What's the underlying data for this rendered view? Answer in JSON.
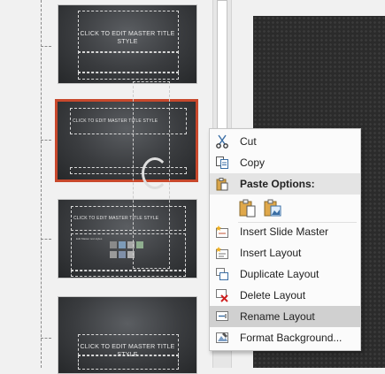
{
  "thumbnails": [
    {
      "title": "CLICK TO EDIT MASTER TITLE STYLE",
      "selected": false
    },
    {
      "title": "CLICK TO EDIT MASTER TITLE STYLE",
      "selected": true
    },
    {
      "title": "CLICK TO EDIT MASTER TITLE STYLE",
      "selected": false,
      "body": "Edit Master text styles"
    },
    {
      "title": "CLICK TO EDIT MASTER TITLE STYLE",
      "selected": false
    }
  ],
  "context_menu": {
    "items": [
      {
        "label": "Cut",
        "icon": "scissors-icon"
      },
      {
        "label": "Copy",
        "icon": "copy-icon"
      },
      {
        "label": "Paste Options:",
        "icon": "paste-icon",
        "header": true
      },
      {
        "label": "Insert Slide Master",
        "icon": "insert-slide-master-icon"
      },
      {
        "label": "Insert Layout",
        "icon": "insert-layout-icon"
      },
      {
        "label": "Duplicate Layout",
        "icon": "duplicate-layout-icon"
      },
      {
        "label": "Delete Layout",
        "icon": "delete-layout-icon"
      },
      {
        "label": "Rename Layout",
        "icon": "rename-layout-icon",
        "highlighted": true
      },
      {
        "label": "Format Background...",
        "icon": "format-background-icon"
      }
    ],
    "paste_options": [
      {
        "icon": "paste-use-destination-theme-icon"
      },
      {
        "icon": "paste-picture-icon"
      }
    ]
  },
  "colors": {
    "selection_border": "#c8482c",
    "menu_highlight": "#d0d0d0"
  }
}
